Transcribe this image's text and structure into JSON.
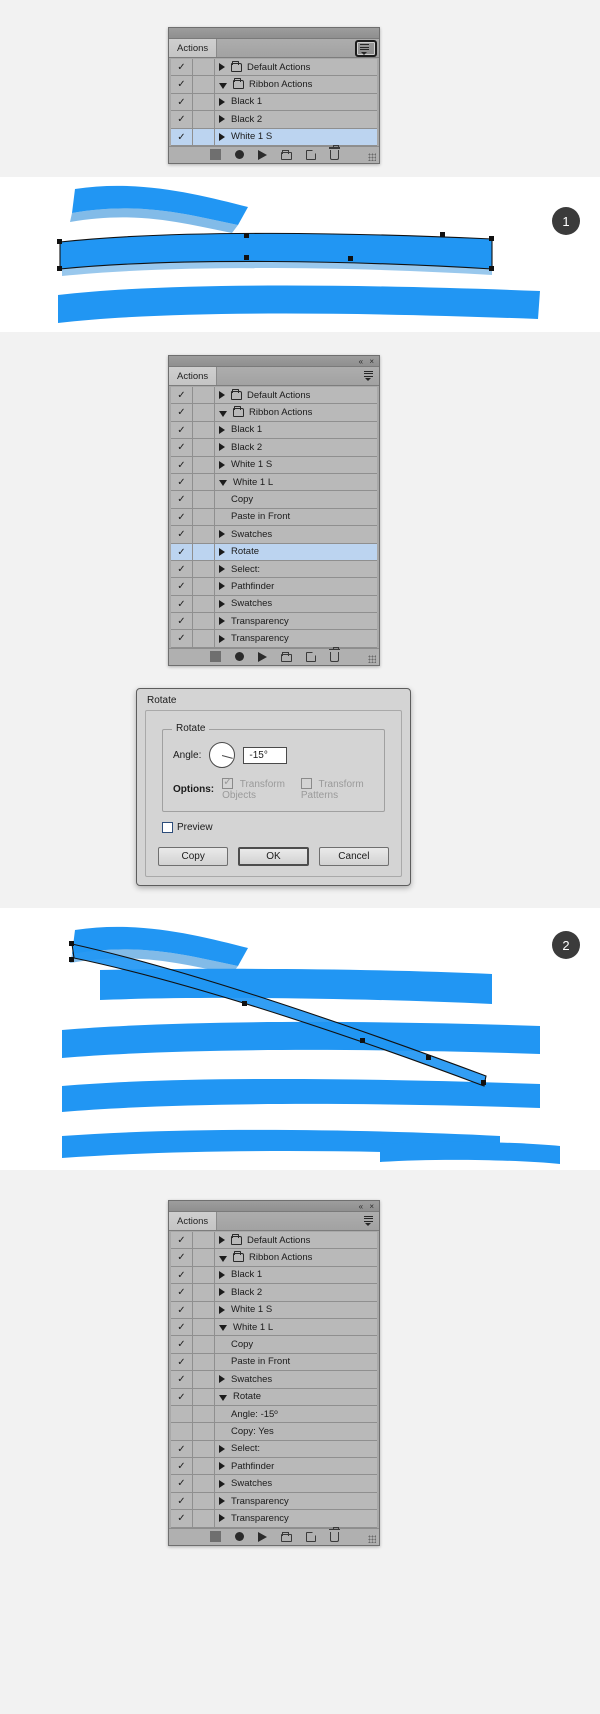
{
  "panels": {
    "panel1": {
      "tab_label": "Actions",
      "rows": [
        {
          "check": "✓",
          "indent": 1,
          "arrow": "right",
          "folder": true,
          "label": "Default Actions",
          "selected": false
        },
        {
          "check": "✓",
          "indent": 1,
          "arrow": "down",
          "folder": true,
          "label": "Ribbon Actions",
          "selected": false
        },
        {
          "check": "✓",
          "indent": 2,
          "arrow": "right",
          "folder": false,
          "label": "Black 1",
          "selected": false
        },
        {
          "check": "✓",
          "indent": 2,
          "arrow": "right",
          "folder": false,
          "label": "Black 2",
          "selected": false
        },
        {
          "check": "✓",
          "indent": 2,
          "arrow": "right",
          "folder": false,
          "label": "White 1 S",
          "selected": true
        }
      ]
    },
    "panel2": {
      "tab_label": "Actions",
      "window_buttons": "«  ×",
      "rows": [
        {
          "check": "✓",
          "indent": 1,
          "arrow": "right",
          "folder": true,
          "label": "Default Actions",
          "selected": false
        },
        {
          "check": "✓",
          "indent": 1,
          "arrow": "down",
          "folder": true,
          "label": "Ribbon Actions",
          "selected": false
        },
        {
          "check": "✓",
          "indent": 2,
          "arrow": "right",
          "folder": false,
          "label": "Black 1",
          "selected": false
        },
        {
          "check": "✓",
          "indent": 2,
          "arrow": "right",
          "folder": false,
          "label": "Black 2",
          "selected": false
        },
        {
          "check": "✓",
          "indent": 2,
          "arrow": "right",
          "folder": false,
          "label": "White 1 S",
          "selected": false
        },
        {
          "check": "✓",
          "indent": 2,
          "arrow": "down",
          "folder": false,
          "label": "White 1 L",
          "selected": false
        },
        {
          "check": "✓",
          "indent": 3,
          "arrow": "none",
          "folder": false,
          "label": "Copy",
          "selected": false
        },
        {
          "check": "✓",
          "indent": 3,
          "arrow": "none",
          "folder": false,
          "label": "Paste in Front",
          "selected": false
        },
        {
          "check": "✓",
          "indent": 3,
          "arrow": "right",
          "folder": false,
          "label": "Swatches",
          "selected": false
        },
        {
          "check": "✓",
          "indent": 3,
          "arrow": "right",
          "folder": false,
          "label": "Rotate",
          "selected": true
        },
        {
          "check": "✓",
          "indent": 3,
          "arrow": "right",
          "folder": false,
          "label": "Select:",
          "selected": false
        },
        {
          "check": "✓",
          "indent": 3,
          "arrow": "right",
          "folder": false,
          "label": "Pathfinder",
          "selected": false
        },
        {
          "check": "✓",
          "indent": 3,
          "arrow": "right",
          "folder": false,
          "label": "Swatches",
          "selected": false
        },
        {
          "check": "✓",
          "indent": 3,
          "arrow": "right",
          "folder": false,
          "label": "Transparency",
          "selected": false
        },
        {
          "check": "✓",
          "indent": 3,
          "arrow": "right",
          "folder": false,
          "label": "Transparency",
          "selected": false
        }
      ]
    },
    "panel3": {
      "tab_label": "Actions",
      "window_buttons": "«  ×",
      "rows": [
        {
          "check": "✓",
          "indent": 1,
          "arrow": "right",
          "folder": true,
          "label": "Default Actions",
          "selected": false
        },
        {
          "check": "✓",
          "indent": 1,
          "arrow": "down",
          "folder": true,
          "label": "Ribbon Actions",
          "selected": false
        },
        {
          "check": "✓",
          "indent": 2,
          "arrow": "right",
          "folder": false,
          "label": "Black 1",
          "selected": false
        },
        {
          "check": "✓",
          "indent": 2,
          "arrow": "right",
          "folder": false,
          "label": "Black 2",
          "selected": false
        },
        {
          "check": "✓",
          "indent": 2,
          "arrow": "right",
          "folder": false,
          "label": "White 1 S",
          "selected": false
        },
        {
          "check": "✓",
          "indent": 2,
          "arrow": "down",
          "folder": false,
          "label": "White 1 L",
          "selected": false
        },
        {
          "check": "✓",
          "indent": 3,
          "arrow": "none",
          "folder": false,
          "label": "Copy",
          "selected": false
        },
        {
          "check": "✓",
          "indent": 3,
          "arrow": "none",
          "folder": false,
          "label": "Paste in Front",
          "selected": false
        },
        {
          "check": "✓",
          "indent": 3,
          "arrow": "right",
          "folder": false,
          "label": "Swatches",
          "selected": false
        },
        {
          "check": "✓",
          "indent": 3,
          "arrow": "down",
          "folder": false,
          "label": "Rotate",
          "selected": false
        },
        {
          "check": "",
          "indent": 4,
          "arrow": "none",
          "folder": false,
          "label": "Angle: -15º",
          "selected": false
        },
        {
          "check": "",
          "indent": 4,
          "arrow": "none",
          "folder": false,
          "label": "Copy: Yes",
          "selected": false
        },
        {
          "check": "✓",
          "indent": 3,
          "arrow": "right",
          "folder": false,
          "label": "Select:",
          "selected": false
        },
        {
          "check": "✓",
          "indent": 3,
          "arrow": "right",
          "folder": false,
          "label": "Pathfinder",
          "selected": false
        },
        {
          "check": "✓",
          "indent": 3,
          "arrow": "right",
          "folder": false,
          "label": "Swatches",
          "selected": false
        },
        {
          "check": "✓",
          "indent": 3,
          "arrow": "right",
          "folder": false,
          "label": "Transparency",
          "selected": false
        },
        {
          "check": "✓",
          "indent": 3,
          "arrow": "right",
          "folder": false,
          "label": "Transparency",
          "selected": false
        }
      ]
    }
  },
  "footer_icons": [
    {
      "name": "stop-icon",
      "title": "Stop"
    },
    {
      "name": "record-icon",
      "title": "Begin recording"
    },
    {
      "name": "play-icon",
      "title": "Play current selection"
    },
    {
      "name": "new-set-icon",
      "title": "Create new set"
    },
    {
      "name": "new-action-icon",
      "title": "Create new action"
    },
    {
      "name": "delete-icon",
      "title": "Delete selection"
    }
  ],
  "dialog": {
    "title": "Rotate",
    "group_legend": "Rotate",
    "angle_label": "Angle:",
    "angle_value": "-15°",
    "options_label": "Options:",
    "transform_objects_label": "Transform Objects",
    "transform_patterns_label": "Transform Patterns",
    "transform_objects_checked": true,
    "transform_patterns_checked": false,
    "preview_label": "Preview",
    "preview_checked": false,
    "copy_button": "Copy",
    "ok_button": "OK",
    "cancel_button": "Cancel"
  },
  "illustrations": {
    "step1_badge": "1",
    "step2_badge": "2",
    "ribbon_color": "#2196f3",
    "ribbon_shadow": "#1c84d6"
  }
}
